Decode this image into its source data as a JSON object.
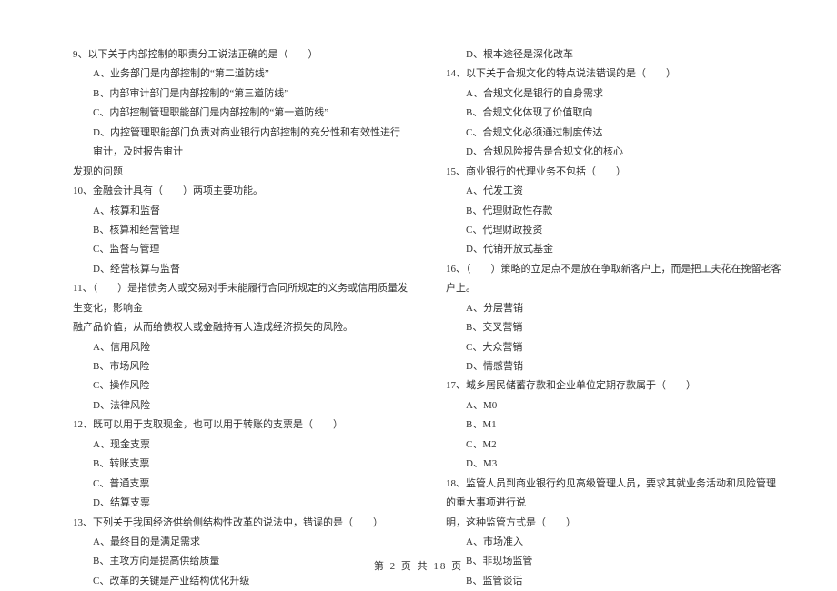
{
  "left": {
    "q9": {
      "stem": "9、以下关于内部控制的职责分工说法正确的是（　　）",
      "a": "A、业务部门是内部控制的“第二道防线”",
      "b": "B、内部审计部门是内部控制的“第三道防线”",
      "c": "C、内部控制管理职能部门是内部控制的“第一道防线”",
      "d": "D、内控管理职能部门负责对商业银行内部控制的充分性和有效性进行审计，及时报告审计",
      "d2": "发现的问题"
    },
    "q10": {
      "stem": "10、金融会计具有（　　）两项主要功能。",
      "a": "A、核算和监督",
      "b": "B、核算和经营管理",
      "c": "C、监督与管理",
      "d": "D、经营核算与监督"
    },
    "q11": {
      "stem": "11、（　　）是指债务人或交易对手未能履行合同所规定的义务或信用质量发生变化，影响金",
      "stem2": "融产品价值，从而给债权人或金融持有人造成经济损失的风险。",
      "a": "A、信用风险",
      "b": "B、市场风险",
      "c": "C、操作风险",
      "d": "D、法律风险"
    },
    "q12": {
      "stem": "12、既可以用于支取现金，也可以用于转账的支票是（　　）",
      "a": "A、现金支票",
      "b": "B、转账支票",
      "c": "C、普通支票",
      "d": "D、结算支票"
    },
    "q13": {
      "stem": "13、下列关于我国经济供给侧结构性改革的说法中，错误的是（　　）",
      "a": "A、最终目的是满足需求",
      "b": "B、主攻方向是提高供给质量",
      "c": "C、改革的关键是产业结构优化升级"
    }
  },
  "right": {
    "q13d": "D、根本途径是深化改革",
    "q14": {
      "stem": "14、以下关于合规文化的特点说法错误的是（　　）",
      "a": "A、合规文化是银行的自身需求",
      "b": "B、合规文化体现了价值取向",
      "c": "C、合规文化必须通过制度传达",
      "d": "D、合规风险报告是合规文化的核心"
    },
    "q15": {
      "stem": "15、商业银行的代理业务不包括（　　）",
      "a": "A、代发工资",
      "b": "B、代理财政性存款",
      "c": "C、代理财政投资",
      "d": "D、代销开放式基金"
    },
    "q16": {
      "stem": "16、（　　）策略的立足点不是放在争取新客户上，而是把工夫花在挽留老客户上。",
      "a": "A、分层营销",
      "b": "B、交叉营销",
      "c": "C、大众营销",
      "d": "D、情感营销"
    },
    "q17": {
      "stem": "17、城乡居民储蓄存款和企业单位定期存款属于（　　）",
      "a": "A、M0",
      "b": "B、M1",
      "c": "C、M2",
      "d": "D、M3"
    },
    "q18": {
      "stem": "18、监管人员到商业银行约见高级管理人员，要求其就业务活动和风险管理的重大事项进行说",
      "stem2": "明，这种监管方式是（　　）",
      "a": "A、市场准入",
      "b": "B、非现场监管",
      "c": "B、监管谈话"
    }
  },
  "footer": "第 2 页 共 18 页"
}
